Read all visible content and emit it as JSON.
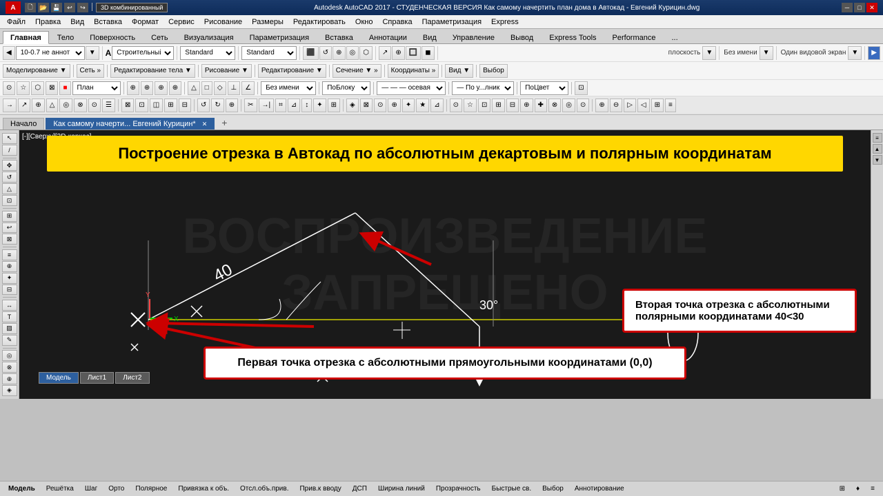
{
  "titlebar": {
    "logo": "A",
    "title": "Autodesk AutoCAD 2017 - СТУДЕНЧЕСКАЯ ВЕРСИЯ    Как самому начертить план дома в Автокад - Евгений Курицин.dwg",
    "toolbar_icons": [
      "new",
      "open",
      "save",
      "save_as",
      "undo",
      "redo",
      "plot",
      "preview",
      "workspace"
    ]
  },
  "workspace_selector": "3D комбинированный",
  "menubar": {
    "items": [
      "Файл",
      "Правка",
      "Вид",
      "Вставка",
      "Формат",
      "Сервис",
      "Рисование",
      "Размеры",
      "Редактировать",
      "Окно",
      "Справка",
      "Параметризация",
      "Express"
    ]
  },
  "ribbontabs": {
    "items": [
      "Главная",
      "Тело",
      "Поверхность",
      "Сеть",
      "Визуализация",
      "Параметризация",
      "Вставка",
      "Аннотации",
      "Вид",
      "Управление",
      "Вывод",
      "Express Tools",
      "Performance",
      "..."
    ]
  },
  "toolbar_row1": {
    "layer_items": [
      "10-0.7 не аннот",
      "Строительный",
      "Standard",
      "Standard"
    ],
    "buttons": [
      "Строительный"
    ]
  },
  "toolbar_row2": {
    "plan": "План",
    "bez_imeni": "Без имени",
    "pobloku": "ПоБлоку",
    "osevaya": "осевая",
    "po_utochnik": "По у...лник",
    "poCvet": "ПоЦвет"
  },
  "tabs": {
    "items": [
      {
        "label": "Начало",
        "active": false
      },
      {
        "label": "Как самому начерти... Евгений Курицин*",
        "active": true
      }
    ],
    "new_tab": "+"
  },
  "viewport_label": "[-][Сверху][2D-каркас]",
  "banner": {
    "text": "Построение отрезка в Автокад по абсолютным декартовым и полярным координатам"
  },
  "callout_top": {
    "text": "Вторая точка отрезка с абсолютными полярными координатами 40<30"
  },
  "callout_bottom": {
    "text": "Первая точка отрезка с абсолютными прямоугольными координатами (0,0)"
  },
  "drawing": {
    "dimension_40": "40",
    "dimension_30": "30°"
  },
  "watermark": {
    "line1": "ВОСПРОИЗВЕДЕНИЕ",
    "line2": "ЗАПРЕЩЕНО"
  },
  "statusbar": {
    "buttons": [
      "Модель",
      "Решётка",
      "Шаг",
      "Орто",
      "Полярное",
      "Привязка к объ.",
      "Отсл.объ.прив.",
      "Прив.к вводу",
      "ДСП",
      "Ширина линий",
      "Прозрачность",
      "Быстрые св.",
      "Выбор",
      "Аннотирование"
    ],
    "right": [
      "⊞",
      "♦",
      "≡"
    ]
  },
  "model_tabs": [
    "Модель",
    "Лист1",
    "Лист2"
  ],
  "colors": {
    "accent_blue": "#2d5f9e",
    "toolbar_bg": "#f0f0f0",
    "canvas_bg": "#1a1a1a",
    "banner_bg": "#ffd700",
    "callout_border": "#cc0000",
    "callout_bg": "#ffffff",
    "drawing_line": "#ffffff",
    "arrow_color": "#cc0000",
    "yellow_line": "#dddd00",
    "title_bg": "#1a3a6b"
  }
}
